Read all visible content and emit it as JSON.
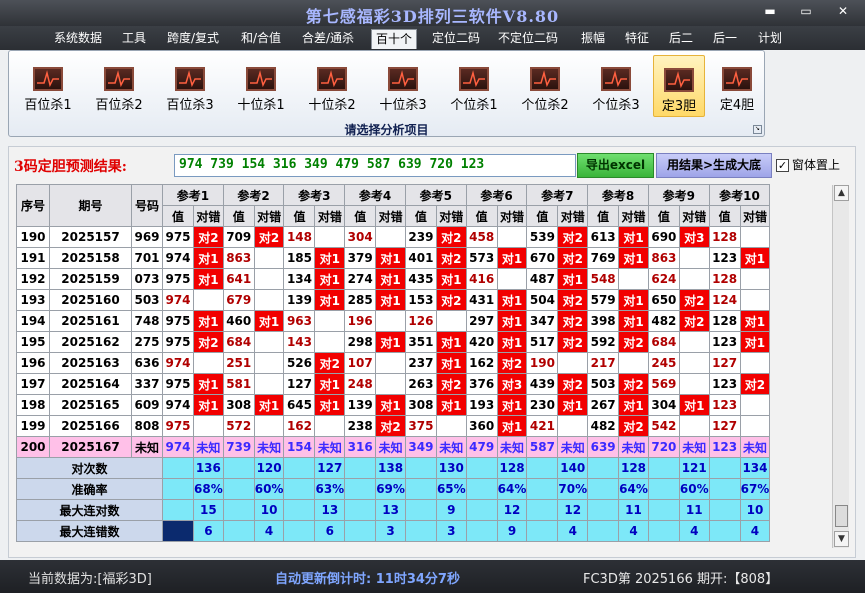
{
  "window": {
    "title": "第七感福彩3D排列三软件V8.80",
    "btn_min": "▬",
    "btn_max": "▭",
    "btn_close": "✕"
  },
  "menu": [
    {
      "label": "系统数据"
    },
    {
      "label": "工具"
    },
    {
      "label": "跨度/复式"
    },
    {
      "label": "和/合值"
    },
    {
      "label": "合差/通杀"
    },
    {
      "label": "百十个",
      "active": true
    },
    {
      "label": "定位二码"
    },
    {
      "label": "不定位二码"
    },
    {
      "label": "振幅"
    },
    {
      "label": "特征"
    },
    {
      "label": "后二"
    },
    {
      "label": "后一"
    },
    {
      "label": "计划"
    }
  ],
  "ribbon": {
    "caption": "请选择分析项目",
    "buttons": [
      {
        "label": "百位杀1"
      },
      {
        "label": "百位杀2"
      },
      {
        "label": "百位杀3"
      },
      {
        "label": "十位杀1"
      },
      {
        "label": "十位杀2"
      },
      {
        "label": "十位杀3"
      },
      {
        "label": "个位杀1"
      },
      {
        "label": "个位杀2"
      },
      {
        "label": "个位杀3"
      },
      {
        "label": "定3胆",
        "active": true
      },
      {
        "label": "定4胆"
      }
    ]
  },
  "prediction": {
    "label": "3码定胆预测结果:",
    "value": "974 739 154 316 349 479 587 639 720 123"
  },
  "buttons": {
    "excel": "导出excel",
    "generate": "用结果>生成大底"
  },
  "topmost": {
    "label": "窗体置上",
    "checked": "✓"
  },
  "table": {
    "headers": {
      "seq": "序号",
      "period": "期号",
      "number": "号码",
      "value": "值",
      "hit": "对错"
    },
    "refs": [
      "参考1",
      "参考2",
      "参考3",
      "参考4",
      "参考5",
      "参考6",
      "参考7",
      "参考8",
      "参考9",
      "参考10"
    ],
    "rows": [
      {
        "seq": "190",
        "period": "2025157",
        "number": "969",
        "cells": [
          [
            "975",
            "对2",
            0
          ],
          [
            "709",
            "对2",
            0
          ],
          [
            "148",
            "",
            1
          ],
          [
            "304",
            "",
            1
          ],
          [
            "239",
            "对2",
            0
          ],
          [
            "458",
            "",
            1
          ],
          [
            "539",
            "对2",
            0
          ],
          [
            "613",
            "对1",
            0
          ],
          [
            "690",
            "对3",
            0
          ],
          [
            "128",
            "",
            1
          ]
        ]
      },
      {
        "seq": "191",
        "period": "2025158",
        "number": "701",
        "cells": [
          [
            "974",
            "对1",
            0
          ],
          [
            "863",
            "",
            1
          ],
          [
            "185",
            "对1",
            0
          ],
          [
            "379",
            "对1",
            0
          ],
          [
            "401",
            "对2",
            0
          ],
          [
            "573",
            "对1",
            0
          ],
          [
            "670",
            "对2",
            0
          ],
          [
            "769",
            "对1",
            0
          ],
          [
            "863",
            "",
            1
          ],
          [
            "123",
            "对1",
            0
          ]
        ]
      },
      {
        "seq": "192",
        "period": "2025159",
        "number": "073",
        "cells": [
          [
            "975",
            "对1",
            0
          ],
          [
            "641",
            "",
            1
          ],
          [
            "134",
            "对1",
            0
          ],
          [
            "274",
            "对1",
            0
          ],
          [
            "435",
            "对1",
            0
          ],
          [
            "416",
            "",
            1
          ],
          [
            "487",
            "对1",
            0
          ],
          [
            "548",
            "",
            1
          ],
          [
            "624",
            "",
            1
          ],
          [
            "128",
            "",
            1
          ]
        ]
      },
      {
        "seq": "193",
        "period": "2025160",
        "number": "503",
        "cells": [
          [
            "974",
            "",
            1
          ],
          [
            "679",
            "",
            1
          ],
          [
            "139",
            "对1",
            0
          ],
          [
            "285",
            "对1",
            0
          ],
          [
            "153",
            "对2",
            0
          ],
          [
            "431",
            "对1",
            0
          ],
          [
            "504",
            "对2",
            0
          ],
          [
            "579",
            "对1",
            0
          ],
          [
            "650",
            "对2",
            0
          ],
          [
            "124",
            "",
            1
          ]
        ]
      },
      {
        "seq": "194",
        "period": "2025161",
        "number": "748",
        "cells": [
          [
            "975",
            "对1",
            0
          ],
          [
            "460",
            "对1",
            0
          ],
          [
            "963",
            "",
            1
          ],
          [
            "196",
            "",
            1
          ],
          [
            "126",
            "",
            1
          ],
          [
            "297",
            "对1",
            0
          ],
          [
            "347",
            "对2",
            0
          ],
          [
            "398",
            "对1",
            0
          ],
          [
            "482",
            "对2",
            0
          ],
          [
            "128",
            "对1",
            0
          ]
        ]
      },
      {
        "seq": "195",
        "period": "2025162",
        "number": "275",
        "cells": [
          [
            "975",
            "对2",
            0
          ],
          [
            "684",
            "",
            1
          ],
          [
            "143",
            "",
            1
          ],
          [
            "298",
            "对1",
            0
          ],
          [
            "351",
            "对1",
            0
          ],
          [
            "420",
            "对1",
            0
          ],
          [
            "517",
            "对2",
            0
          ],
          [
            "592",
            "对2",
            0
          ],
          [
            "684",
            "",
            1
          ],
          [
            "123",
            "对1",
            0
          ]
        ]
      },
      {
        "seq": "196",
        "period": "2025163",
        "number": "636",
        "cells": [
          [
            "974",
            "",
            1
          ],
          [
            "251",
            "",
            1
          ],
          [
            "526",
            "对2",
            0
          ],
          [
            "107",
            "",
            1
          ],
          [
            "237",
            "对1",
            0
          ],
          [
            "162",
            "对2",
            0
          ],
          [
            "190",
            "",
            1
          ],
          [
            "217",
            "",
            1
          ],
          [
            "245",
            "",
            1
          ],
          [
            "127",
            "",
            1
          ]
        ]
      },
      {
        "seq": "197",
        "period": "2025164",
        "number": "337",
        "cells": [
          [
            "975",
            "对1",
            0
          ],
          [
            "581",
            "",
            1
          ],
          [
            "127",
            "对1",
            0
          ],
          [
            "248",
            "",
            1
          ],
          [
            "263",
            "对2",
            0
          ],
          [
            "376",
            "对3",
            0
          ],
          [
            "439",
            "对2",
            0
          ],
          [
            "503",
            "对2",
            0
          ],
          [
            "569",
            "",
            1
          ],
          [
            "123",
            "对2",
            0
          ]
        ]
      },
      {
        "seq": "198",
        "period": "2025165",
        "number": "609",
        "cells": [
          [
            "974",
            "对1",
            0
          ],
          [
            "308",
            "对1",
            0
          ],
          [
            "645",
            "对1",
            0
          ],
          [
            "139",
            "对1",
            0
          ],
          [
            "308",
            "对1",
            0
          ],
          [
            "193",
            "对1",
            0
          ],
          [
            "230",
            "对1",
            0
          ],
          [
            "267",
            "对1",
            0
          ],
          [
            "304",
            "对1",
            0
          ],
          [
            "123",
            "",
            1
          ]
        ]
      },
      {
        "seq": "199",
        "period": "2025166",
        "number": "808",
        "cells": [
          [
            "975",
            "",
            1
          ],
          [
            "572",
            "",
            1
          ],
          [
            "162",
            "",
            1
          ],
          [
            "238",
            "对2",
            0
          ],
          [
            "375",
            "",
            1
          ],
          [
            "360",
            "对1",
            0
          ],
          [
            "421",
            "",
            1
          ],
          [
            "482",
            "对2",
            0
          ],
          [
            "542",
            "",
            1
          ],
          [
            "127",
            "",
            1
          ]
        ]
      }
    ],
    "last": {
      "seq": "200",
      "period": "2025167",
      "number": "未知",
      "values": [
        "974",
        "739",
        "154",
        "316",
        "349",
        "479",
        "587",
        "639",
        "720",
        "123"
      ],
      "hit": "未知"
    },
    "stats": [
      {
        "label": "对次数",
        "values": [
          "136",
          "120",
          "127",
          "138",
          "130",
          "128",
          "140",
          "128",
          "121",
          "134"
        ]
      },
      {
        "label": "准确率",
        "values": [
          "68%",
          "60%",
          "63%",
          "69%",
          "65%",
          "64%",
          "70%",
          "64%",
          "60%",
          "67%"
        ]
      },
      {
        "label": "最大连对数",
        "values": [
          "15",
          "10",
          "13",
          "13",
          "9",
          "12",
          "12",
          "11",
          "11",
          "10"
        ]
      },
      {
        "label": "最大连错数",
        "values": [
          "6",
          "4",
          "6",
          "3",
          "3",
          "9",
          "4",
          "4",
          "4",
          "4"
        ]
      }
    ]
  },
  "status": {
    "current": "当前数据为:[福彩3D]",
    "countdown": "自动更新倒计时: 11时34分7秒",
    "period": "FC3D第 2025166 期开:【808】"
  },
  "scroll": {
    "up": "▲",
    "down": "▼"
  }
}
